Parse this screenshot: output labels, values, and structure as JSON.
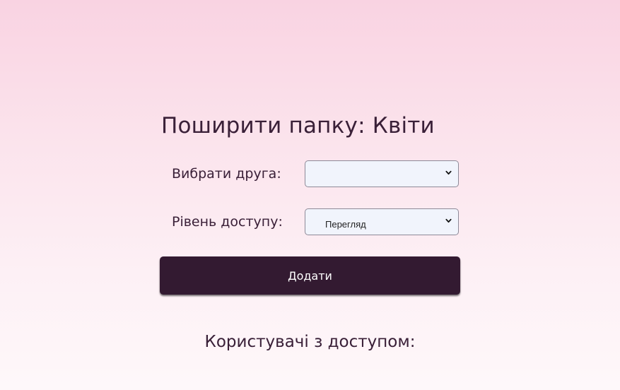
{
  "page_title": "Поширити папку: Квіти",
  "form": {
    "friend_label": "Вибрати друга:",
    "friend_value": "",
    "access_label": "Рівень доступу:",
    "access_value": "Перегляд",
    "add_button_label": "Додати"
  },
  "users_heading": "Користувачі з доступом:",
  "colors": {
    "accent": "#331a31",
    "text": "#3a2038",
    "select_bg": "#f1f4fc",
    "background_top": "#f9d3e2",
    "background_bottom": "#fef8fa"
  },
  "icons": {
    "select_arrow": "chevron-down-icon"
  }
}
